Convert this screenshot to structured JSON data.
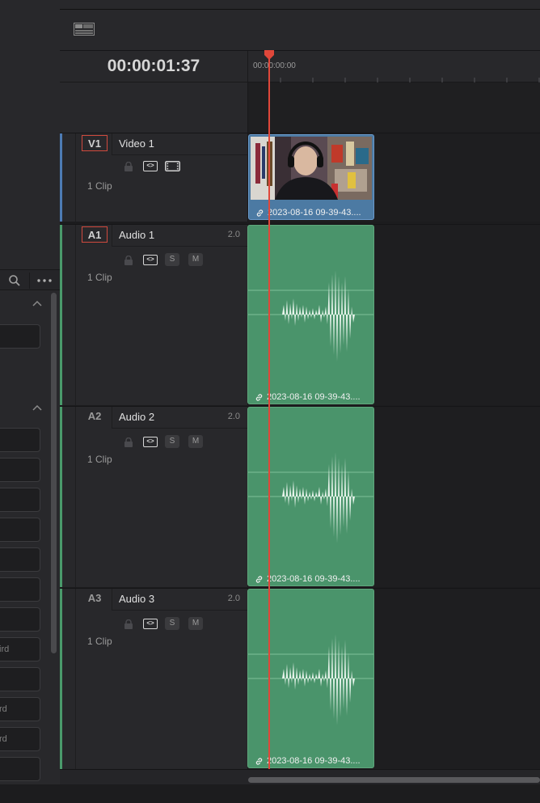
{
  "timecode": "00:00:01:37",
  "ruler": {
    "start_label": "00:00:00:00"
  },
  "tracks": [
    {
      "id": "V1",
      "name": "Video 1",
      "channels": "",
      "clips": "1 Clip",
      "armed": true,
      "type": "video",
      "color": "#4d7bb4"
    },
    {
      "id": "A1",
      "name": "Audio 1",
      "channels": "2.0",
      "clips": "1 Clip",
      "armed": true,
      "type": "audio",
      "color": "#4a9a6b"
    },
    {
      "id": "A2",
      "name": "Audio 2",
      "channels": "2.0",
      "clips": "1 Clip",
      "armed": false,
      "type": "audio",
      "color": "#4a9a6b"
    },
    {
      "id": "A3",
      "name": "Audio 3",
      "channels": "2.0",
      "clips": "1 Clip",
      "armed": false,
      "type": "audio",
      "color": "#4a9a6b"
    }
  ],
  "buttons": {
    "solo": "S",
    "mute": "M"
  },
  "clips": {
    "video": {
      "label": "2023-08-16 09-39-43...."
    },
    "audio1": {
      "label": "2023-08-16 09-39-43...."
    },
    "audio2": {
      "label": "2023-08-16 09-39-43...."
    },
    "audio3": {
      "label": "2023-08-16 09-39-43...."
    }
  },
  "left_panel": {
    "fields": [
      {
        "value": ""
      },
      {
        "value": ""
      },
      {
        "value": ""
      },
      {
        "value": ""
      },
      {
        "value": ""
      },
      {
        "value": ""
      },
      {
        "value": ""
      },
      {
        "value": ""
      },
      {
        "value": "ird"
      },
      {
        "value": ""
      },
      {
        "value": "rd"
      },
      {
        "value": "rd"
      },
      {
        "value": ""
      }
    ]
  },
  "icons": [
    "layout-icon",
    "search-icon",
    "more-icon",
    "chevron-up-icon",
    "lock-icon",
    "auto-track-icon",
    "film-icon",
    "link-icon",
    "playhead-icon"
  ],
  "colors": {
    "playhead": "#e0473a",
    "audio_clip": "#4a946b",
    "video_clip": "#4c7aa3",
    "armed_border": "#d04a3e"
  }
}
